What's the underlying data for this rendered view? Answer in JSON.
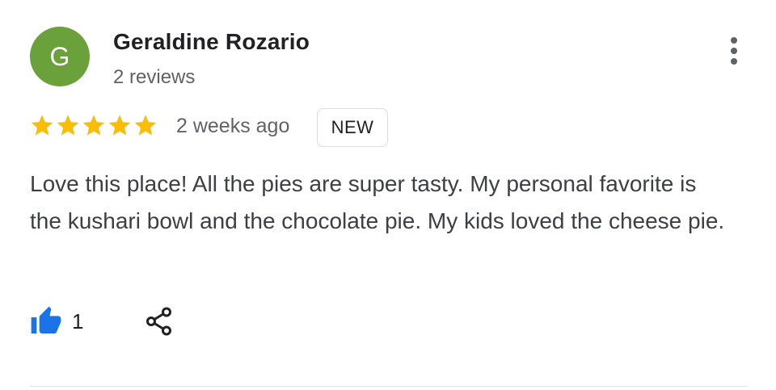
{
  "review": {
    "author": {
      "initial": "G",
      "name": "Geraldine Rozario",
      "review_count": "2 reviews",
      "avatar_color": "#6aa13b"
    },
    "rating": 5,
    "rating_max": 5,
    "star_color": "#fbbc04",
    "time": "2 weeks ago",
    "badge": "NEW",
    "text": "Love this place! All the pies are super tasty. My personal favorite is the kushari bowl and the chocolate pie. My kids loved the cheese pie.",
    "likes": "1",
    "icons": {
      "more": "more-vert-icon",
      "like": "thumb-up-icon",
      "share": "share-icon"
    },
    "like_color": "#1a73e8"
  }
}
